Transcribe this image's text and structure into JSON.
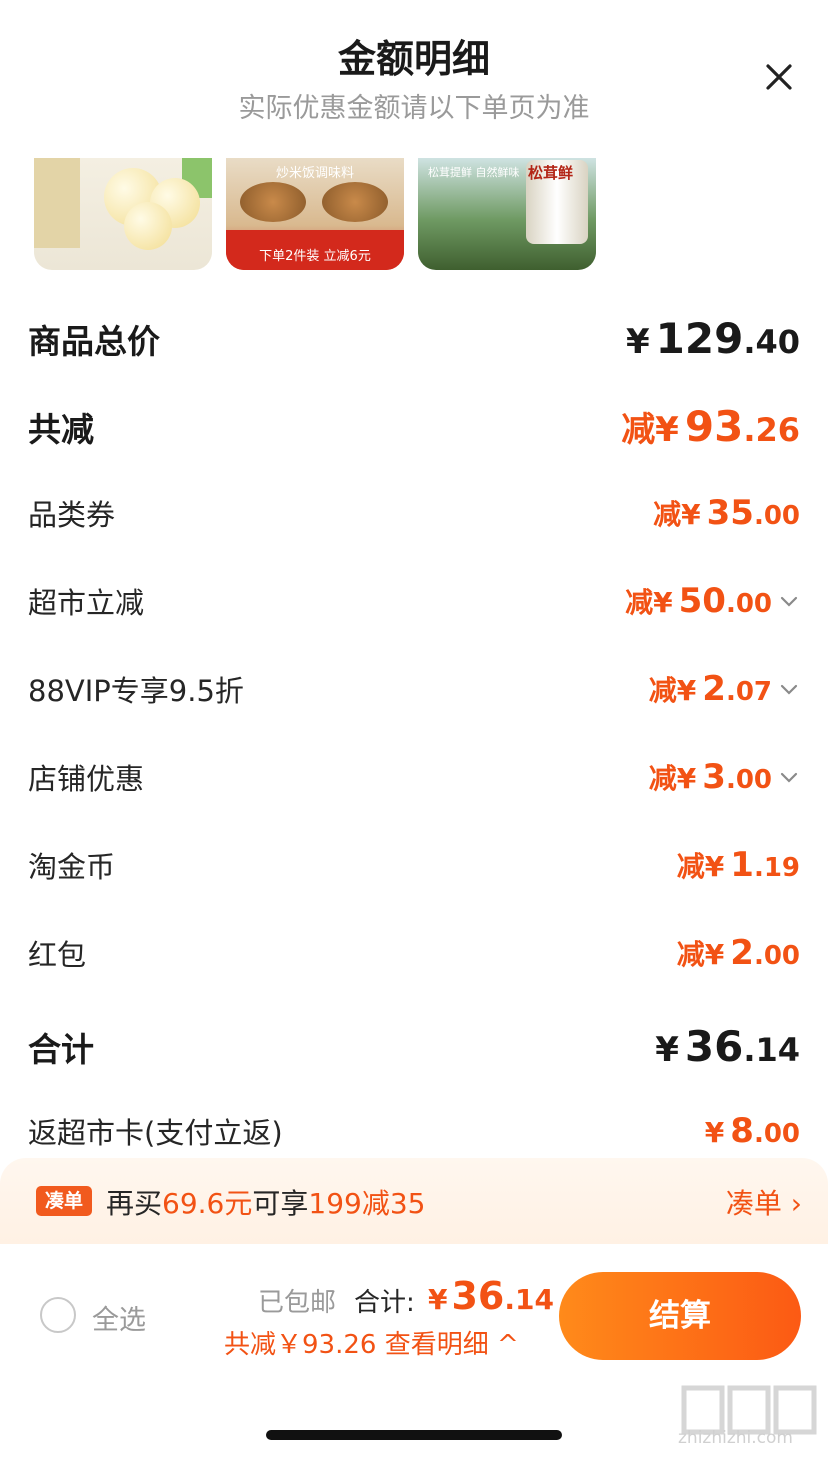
{
  "header": {
    "title": "金额明细",
    "subtitle": "实际优惠金额请以下单页为准"
  },
  "thumbnails": {
    "item2_top": "炒米饭调味料",
    "item2_badge": "下单2件装 立减6元",
    "item3_top": "松茸提鲜 自然鲜味",
    "item3_brand": "松茸鲜"
  },
  "rows": {
    "subtotal": {
      "label": "商品总价",
      "prefix": "¥",
      "int": "129",
      "dec": ".40"
    },
    "total_discount": {
      "label": "共减",
      "prefix": "减¥",
      "int": "93",
      "dec": ".26"
    },
    "category_coupon": {
      "label": "品类券",
      "prefix": "减¥",
      "int": "35",
      "dec": ".00"
    },
    "market_discount": {
      "label": "超市立减",
      "prefix": "减¥",
      "int": "50",
      "dec": ".00"
    },
    "vip": {
      "label": "88VIP专享9.5折",
      "prefix": "减¥",
      "int": "2",
      "dec": ".07"
    },
    "store": {
      "label": "店铺优惠",
      "prefix": "减¥",
      "int": "3",
      "dec": ".00"
    },
    "coins": {
      "label": "淘金币",
      "prefix": "减¥",
      "int": "1",
      "dec": ".19"
    },
    "redpacket": {
      "label": "红包",
      "prefix": "减¥",
      "int": "2",
      "dec": ".00"
    },
    "total": {
      "label": "合计",
      "prefix": "¥",
      "int": "36",
      "dec": ".14"
    },
    "cashback": {
      "label": "返超市卡(支付立返)",
      "prefix": "¥",
      "int": "8",
      "dec": ".00"
    }
  },
  "promo": {
    "tag": "凑单",
    "msg_a": "再买",
    "msg_b": "69.6元",
    "msg_c": "可享",
    "msg_d": "199减35",
    "link": "凑单"
  },
  "footer": {
    "select_all": "全选",
    "shipping": "已包邮",
    "total_label": "合计:",
    "total_prefix": "¥",
    "total_int": "36",
    "total_dec": ".14",
    "detail": "共减￥93.26 查看明细",
    "checkout": "结算"
  },
  "watermark": "zhizhizhi.com",
  "colors": {
    "accent": "#f25214",
    "checkout_start": "#ff8a1a",
    "checkout_end": "#fc5a14"
  }
}
